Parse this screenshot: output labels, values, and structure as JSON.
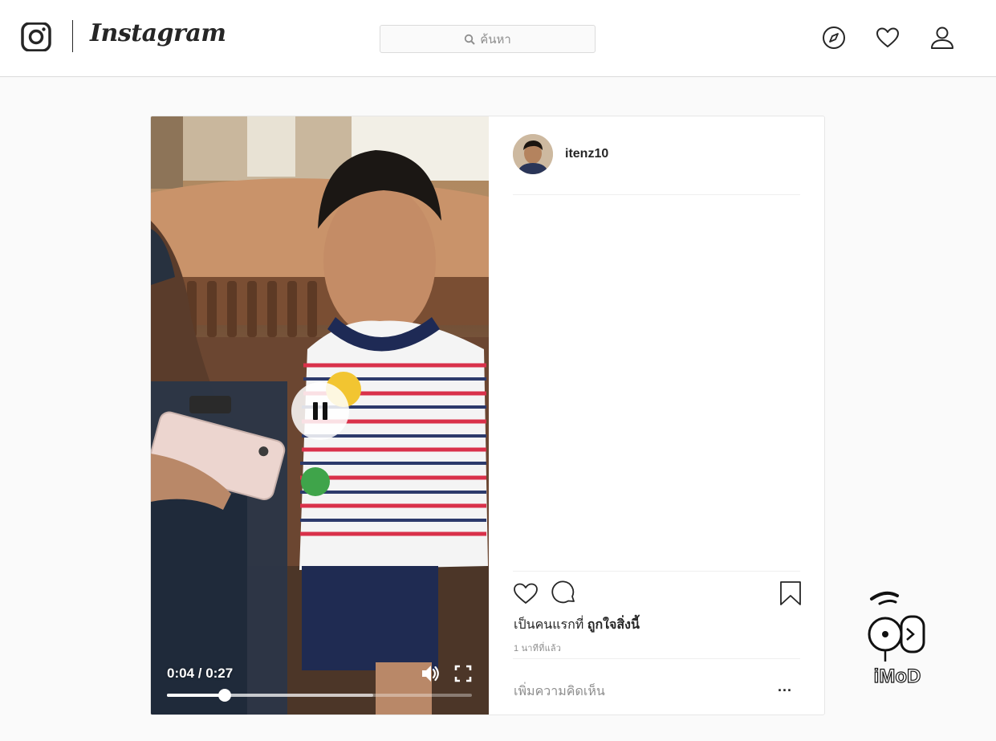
{
  "header": {
    "brand": "Instagram",
    "search_placeholder": "ค้นหา",
    "icons": [
      "instagram-glyph-icon",
      "compass-icon",
      "heart-icon",
      "user-icon"
    ]
  },
  "post": {
    "username": "itenz10",
    "video": {
      "current_time": "0:04",
      "duration": "0:27",
      "time_display": "0:04 / 0:27",
      "progress_fraction": 0.19,
      "buffered_fraction": 0.675
    },
    "likes_text_prefix": "เป็นคนแรกที่ ",
    "likes_text_link": "ถูกใจสิ่งนี้",
    "time_ago": "1 นาทีที่แล้ว",
    "add_comment_placeholder": "เพิ่มความคิดเห็น",
    "more_label": "..."
  },
  "watermark": {
    "text": "iMoD"
  }
}
